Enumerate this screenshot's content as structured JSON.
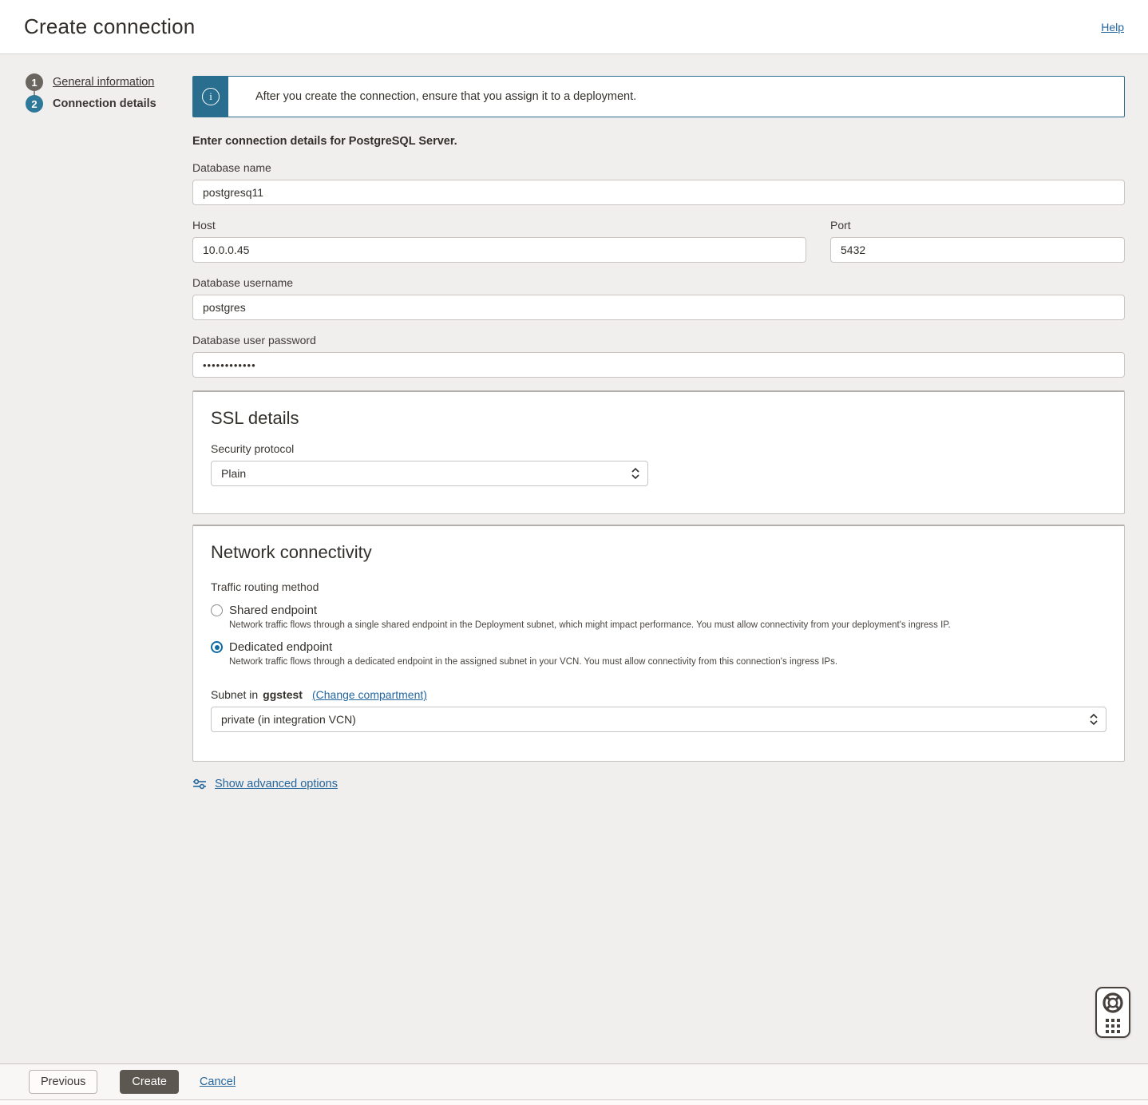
{
  "header": {
    "title": "Create connection",
    "help_label": "Help"
  },
  "stepper": {
    "steps": [
      {
        "number": "1",
        "label": "General information",
        "current": false
      },
      {
        "number": "2",
        "label": "Connection details",
        "current": true
      }
    ]
  },
  "banner": {
    "text": "After you create the connection, ensure that you assign it to a deployment."
  },
  "form": {
    "intro": "Enter connection details for PostgreSQL Server.",
    "database_name": {
      "label": "Database name",
      "value": "postgresq11"
    },
    "host": {
      "label": "Host",
      "value": "10.0.0.45"
    },
    "port": {
      "label": "Port",
      "value": "5432"
    },
    "database_username": {
      "label": "Database username",
      "value": "postgres"
    },
    "database_user_password": {
      "label": "Database user password",
      "value": "••••••••••••"
    }
  },
  "ssl": {
    "title": "SSL details",
    "security_protocol_label": "Security protocol",
    "security_protocol_value": "Plain"
  },
  "network": {
    "title": "Network connectivity",
    "traffic_label": "Traffic routing method",
    "options": [
      {
        "label": "Shared endpoint",
        "description": "Network traffic flows through a single shared endpoint in the Deployment subnet, which might impact performance. You must allow connectivity from your deployment's ingress IP.",
        "selected": false
      },
      {
        "label": "Dedicated endpoint",
        "description": "Network traffic flows through a dedicated endpoint in the assigned subnet in your VCN. You must allow connectivity from this connection's ingress IPs.",
        "selected": true
      }
    ],
    "subnet_label_prefix": "Subnet in",
    "subnet_compartment": "ggstest",
    "change_compartment_label": "(Change compartment)",
    "subnet_value": "private (in integration VCN)"
  },
  "advanced_options_label": "Show advanced options",
  "footer": {
    "previous_label": "Previous",
    "create_label": "Create",
    "cancel_label": "Cancel"
  },
  "colors": {
    "banner_blue": "#2a6e8f",
    "step_done_gray": "#6b655f",
    "step_current_blue": "#2e7899",
    "link_blue": "#24669e",
    "radio_selected_blue": "#0f6ba5",
    "create_button": "#5d5751",
    "page_background": "#f1efee"
  }
}
